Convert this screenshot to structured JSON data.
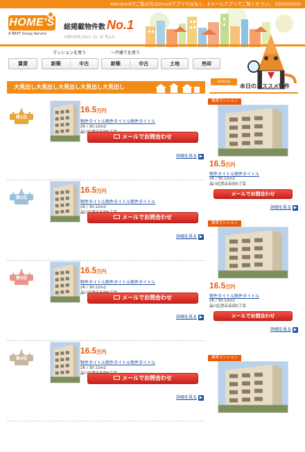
{
  "topbar": {
    "text": "※Androidでご覧の方はGmailアプリではなく、Eメールアプリでご覧ください。 2000/00/00"
  },
  "logo": {
    "text": "HOME'S",
    "sub": "A NEXT Group Service"
  },
  "headline": {
    "label": "総掲載物件数",
    "big": "No.1",
    "note": "※週刊住宅 2011. 12. 12 号より"
  },
  "nav": {
    "mansion_caption": "マンションを買う",
    "house_caption": "一戸建てを買う",
    "buttons": [
      "賃貸",
      "新築",
      "中古",
      "新築",
      "中古",
      "土地",
      "売却"
    ]
  },
  "ranking": {
    "heading": "大見出し大見出し大見出し大見出し大見出し",
    "items": [
      {
        "rank_label": "第1位",
        "price": "16.5",
        "unit": "万円",
        "title": "物件タイトル物件タイトル物件タイトル",
        "layout": "2K / 30.12m2",
        "address": "品川区西五反田5丁目",
        "mail": "メールでお問合わせ",
        "detail": "詳細を見る",
        "crown_color": "#e8a53a"
      },
      {
        "rank_label": "第2位",
        "price": "16.5",
        "unit": "万円",
        "title": "物件タイトル物件タイトル物件タイトル",
        "layout": "2K / 30.12m2",
        "address": "品川区西五反田5丁目",
        "mail": "メールでお問合わせ",
        "detail": "詳細を見る",
        "crown_color": "#9bc1d8"
      },
      {
        "rank_label": "第3位",
        "price": "16.5",
        "unit": "万円",
        "title": "物件タイトル物件タイトル物件タイトル",
        "layout": "2K / 30.12m2",
        "address": "品川区西五反田5丁目",
        "mail": "メールでお問合わせ",
        "detail": "詳細を見る",
        "crown_color": "#e6968a"
      },
      {
        "rank_label": "第4位",
        "price": "16.5",
        "unit": "万円",
        "title": "物件タイトル物件タイトル物件タイトル",
        "layout": "2K / 30.12m2",
        "address": "品川区西五反田5丁目",
        "mail": "メールでお問合わせ",
        "detail": "詳細を見る",
        "crown_color": "#c8b79a"
      }
    ]
  },
  "pickup": {
    "tag": "pickup",
    "heading": "本日のオススメ物件",
    "items": [
      {
        "tag": "賃貸マンション",
        "price": "16.5",
        "unit": "万円",
        "title": "物件タイトル物件タイトル",
        "layout": "2K / 30.12m2",
        "address": "品川区西五反田5丁目",
        "mail": "メールでお問合わせ",
        "detail": "詳細を見る"
      },
      {
        "tag": "賃貸マンション",
        "price": "16.5",
        "unit": "万円",
        "title": "物件タイトル物件タイトル",
        "layout": "2K / 30.12m2",
        "address": "品川区西五反田5丁目",
        "mail": "メールでお問合わせ",
        "detail": "詳細を見る"
      },
      {
        "tag": "賃貸マンション",
        "price": "",
        "unit": "",
        "title": "",
        "layout": "",
        "address": "",
        "mail": "",
        "detail": ""
      }
    ]
  }
}
